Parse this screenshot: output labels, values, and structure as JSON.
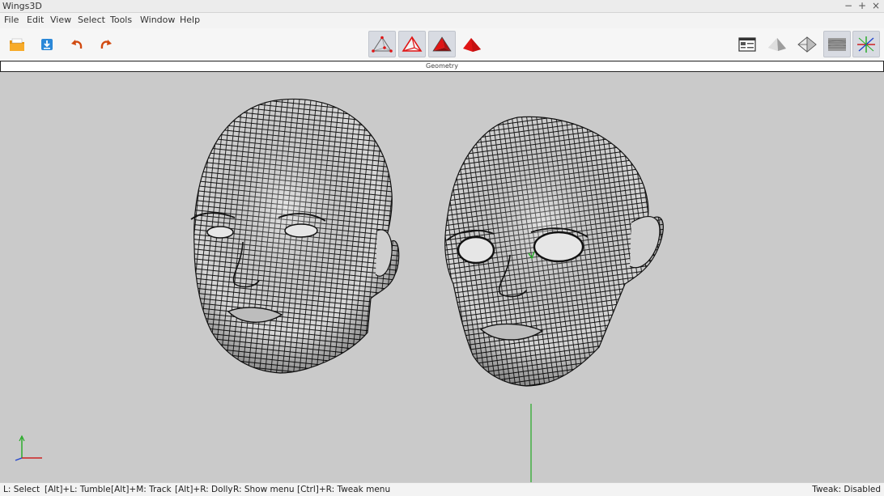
{
  "window": {
    "title": "Wings3D",
    "controls": {
      "minimize": "−",
      "maximize": "+",
      "close": "×"
    }
  },
  "menu": [
    "File",
    "Edit",
    "View",
    "Select",
    "Tools",
    "Window",
    "Help"
  ],
  "toolbar": {
    "left_icons": [
      "open-folder-icon",
      "save-icon",
      "undo-icon",
      "redo-icon"
    ],
    "selection_modes": [
      {
        "icon": "vertex-select-icon",
        "pressed": true
      },
      {
        "icon": "edge-select-icon",
        "pressed": true
      },
      {
        "icon": "face-select-icon",
        "pressed": true
      },
      {
        "icon": "object-select-icon",
        "pressed": false
      }
    ],
    "right_icons": [
      {
        "icon": "view-options-icon",
        "pressed": false
      },
      {
        "icon": "smooth-shading-icon",
        "pressed": false
      },
      {
        "icon": "wireframe-shading-icon",
        "pressed": false
      },
      {
        "icon": "ground-grid-icon",
        "pressed": true
      },
      {
        "icon": "axes-icon",
        "pressed": true
      }
    ]
  },
  "geometry_label": "Geometry",
  "colors": {
    "viewport_bg": "#cacaca",
    "mesh_fill": "#d9d9d9",
    "mesh_lines": "#111111",
    "axis_y": "#22aa22",
    "axis_x": "#cc2222",
    "axis_z": "#2244cc",
    "accent_red": "#e01515"
  },
  "status": {
    "hints": [
      "L: Select",
      "[Alt]+L: Tumble",
      "[Alt]+M: Track",
      "[Alt]+R: Dolly",
      "R: Show menu",
      "[Ctrl]+R: Tweak menu"
    ],
    "tweak": "Tweak: Disabled"
  }
}
